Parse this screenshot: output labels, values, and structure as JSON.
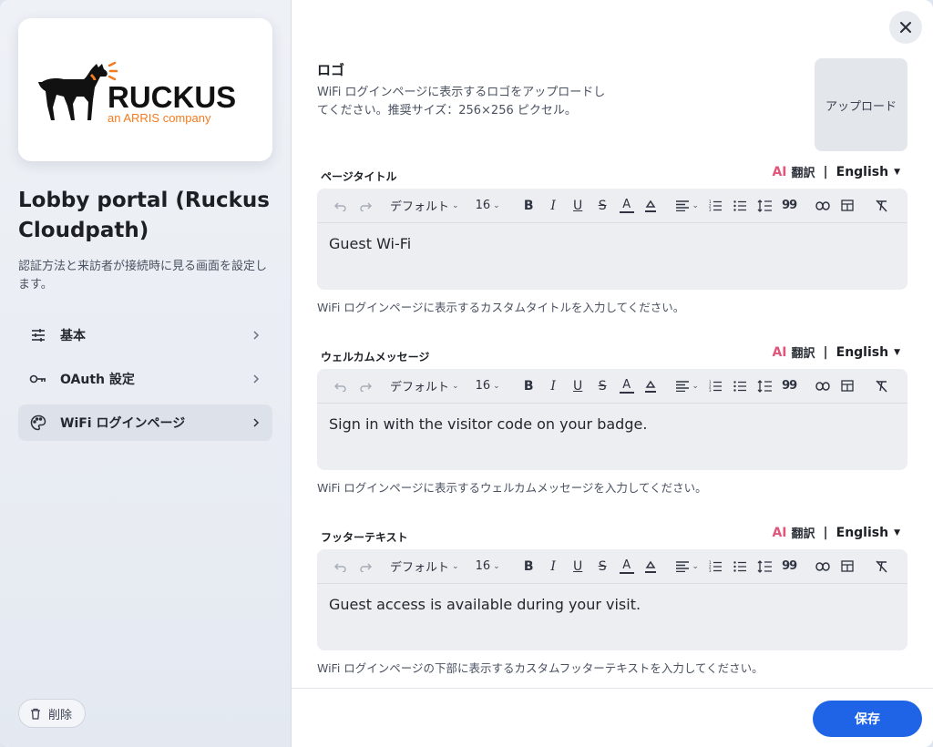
{
  "sidebar": {
    "logo_alt": "RUCKUS an ARRIS company",
    "logo_wordmark": "RUCKUS",
    "logo_tagline": "an ARRIS company",
    "title": "Lobby portal (Ruckus Cloudpath)",
    "description": "認証方法と来訪者が接続時に見る画面を設定します。",
    "nav": [
      {
        "label": "基本",
        "icon": "sliders-icon",
        "active": false
      },
      {
        "label": "OAuth 設定",
        "icon": "key-icon",
        "active": false
      },
      {
        "label": "WiFi ログインページ",
        "icon": "palette-icon",
        "active": true
      }
    ],
    "delete_label": "削除"
  },
  "main": {
    "logo_section": {
      "title": "ロゴ",
      "description": "WiFi ログインページに表示するロゴをアップロードしてください。推奨サイズ：256×256 ピクセル。",
      "upload_label": "アップロード"
    },
    "toolbar": {
      "font": "デフォルト",
      "size": "16"
    },
    "fields": [
      {
        "label": "ページタイトル",
        "ai": "AI",
        "translate": "翻訳",
        "separator": "|",
        "language": "English",
        "content": "Guest Wi-Fi",
        "help": "WiFi ログインページに表示するカスタムタイトルを入力してください。"
      },
      {
        "label": "ウェルカムメッセージ",
        "ai": "AI",
        "translate": "翻訳",
        "separator": "|",
        "language": "English",
        "content": "Sign in with the visitor code on your badge.",
        "help": "WiFi ログインページに表示するウェルカムメッセージを入力してください。"
      },
      {
        "label": "フッターテキスト",
        "ai": "AI",
        "translate": "翻訳",
        "separator": "|",
        "language": "English",
        "content": "Guest access is available during your visit.",
        "help": "WiFi ログインページの下部に表示するカスタムフッターテキストを入力してください。"
      }
    ],
    "save_label": "保存"
  },
  "colors": {
    "accent": "#1f63e6",
    "ai": "#e0567a",
    "brand_orange": "#f47b20"
  }
}
